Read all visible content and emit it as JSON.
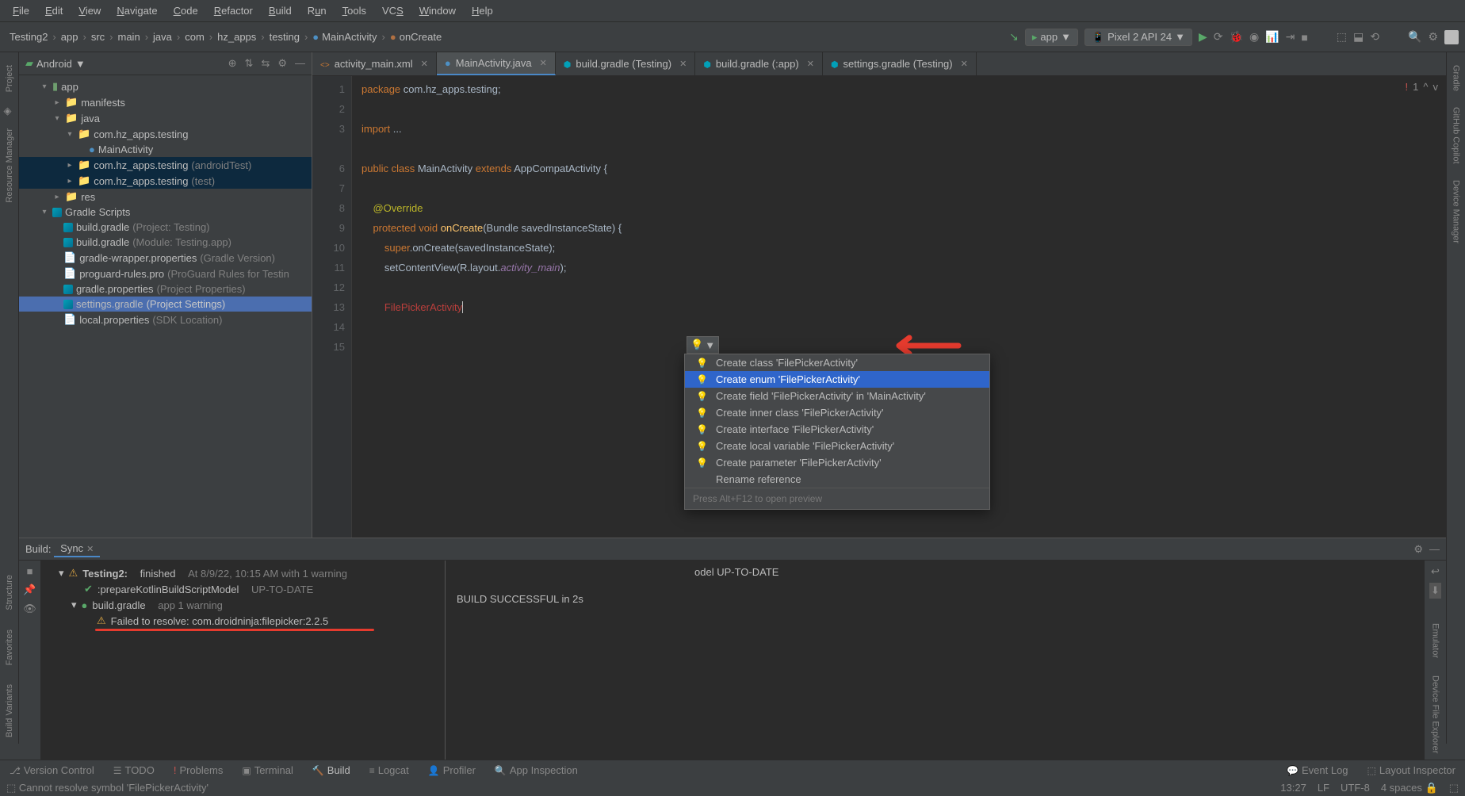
{
  "menu": [
    "File",
    "Edit",
    "View",
    "Navigate",
    "Code",
    "Refactor",
    "Build",
    "Run",
    "Tools",
    "VCS",
    "Window",
    "Help"
  ],
  "crumbs": [
    "Testing2",
    "app",
    "src",
    "main",
    "java",
    "com",
    "hz_apps",
    "testing",
    "MainActivity",
    "onCreate"
  ],
  "nav": {
    "app": "app",
    "device": "Pixel 2 API 24"
  },
  "sidebar": {
    "title": "Android",
    "tree": {
      "app": "app",
      "manifests": "manifests",
      "java": "java",
      "pkg": "com.hz_apps.testing",
      "mainAct": "MainActivity",
      "pkgAT": "com.hz_apps.testing",
      "pkgAT_s": "(androidTest)",
      "pkgT": "com.hz_apps.testing",
      "pkgT_s": "(test)",
      "res": "res",
      "gradle": "Gradle Scripts",
      "bg1": "build.gradle",
      "bg1_s": "(Project: Testing)",
      "bg2": "build.gradle",
      "bg2_s": "(Module: Testing.app)",
      "gw": "gradle-wrapper.properties",
      "gw_s": "(Gradle Version)",
      "pg": "proguard-rules.pro",
      "pg_s": "(ProGuard Rules for Testin",
      "gp": "gradle.properties",
      "gp_s": "(Project Properties)",
      "sg": "settings.gradle",
      "sg_s": "(Project Settings)",
      "lp": "local.properties",
      "lp_s": "(SDK Location)"
    }
  },
  "tabs": [
    {
      "label": "activity_main.xml",
      "type": "xml"
    },
    {
      "label": "MainActivity.java",
      "type": "java",
      "active": true
    },
    {
      "label": "build.gradle (Testing)",
      "type": "grad"
    },
    {
      "label": "build.gradle (:app)",
      "type": "grad"
    },
    {
      "label": "settings.gradle (Testing)",
      "type": "grad"
    }
  ],
  "code": {
    "l1a": "package",
    "l1b": " com.hz_apps.testing;",
    "l3a": "import",
    "l3b": " ...",
    "l6a": "public class ",
    "l6b": "MainActivity ",
    "l6c": "extends ",
    "l6d": "AppCompatActivity {",
    "l8": "@Override",
    "l9a": "protected void ",
    "l9b": "onCreate",
    "l9c": "(Bundle savedInstanceState) {",
    "l10a": "super",
    "l10b": ".onCreate(savedInstanceState);",
    "l11a": "setContentView(R.layout.",
    "l11b": "activity_main",
    "l11c": ");",
    "l13": "FilePickerActivity"
  },
  "err_count": "1",
  "popup": {
    "items": [
      "Create class 'FilePickerActivity'",
      "Create enum 'FilePickerActivity'",
      "Create field 'FilePickerActivity' in 'MainActivity'",
      "Create inner class 'FilePickerActivity'",
      "Create interface 'FilePickerActivity'",
      "Create local variable 'FilePickerActivity'",
      "Create parameter 'FilePickerActivity'",
      "Rename reference"
    ],
    "hint": "Press Alt+F12 to open preview"
  },
  "build": {
    "title": "Build:",
    "tab": "Sync",
    "t2": "Testing2:",
    "t2s": "finished",
    "t2d": "At 8/9/22, 10:15 AM with 1 warning",
    "prep": ":prepareKotlinBuildScriptModel",
    "prep_s": "UP-TO-DATE",
    "bg": "build.gradle",
    "bg_s": "app 1 warning",
    "fail": "Failed to resolve: com.droidninja:filepicker:2.2.5",
    "out1": "odel UP-TO-DATE",
    "out2": "BUILD SUCCESSFUL in 2s"
  },
  "bottom": {
    "vc": "Version Control",
    "todo": "TODO",
    "prob": "Problems",
    "term": "Terminal",
    "build": "Build",
    "logcat": "Logcat",
    "prof": "Profiler",
    "insp": "App Inspection",
    "ev": "Event Log",
    "layout": "Layout Inspector"
  },
  "status": {
    "msg": "Cannot resolve symbol 'FilePickerActivity'",
    "time": "13:27",
    "lf": "LF",
    "enc": "UTF-8",
    "ind": "4 spaces"
  },
  "left_tabs": [
    "Project",
    "Resource Manager",
    "Structure",
    "Favorites",
    "Build Variants"
  ],
  "right_tabs": [
    "Gradle",
    "GitHub Copilot",
    "Device Manager",
    "Emulator",
    "Device File Explorer"
  ]
}
